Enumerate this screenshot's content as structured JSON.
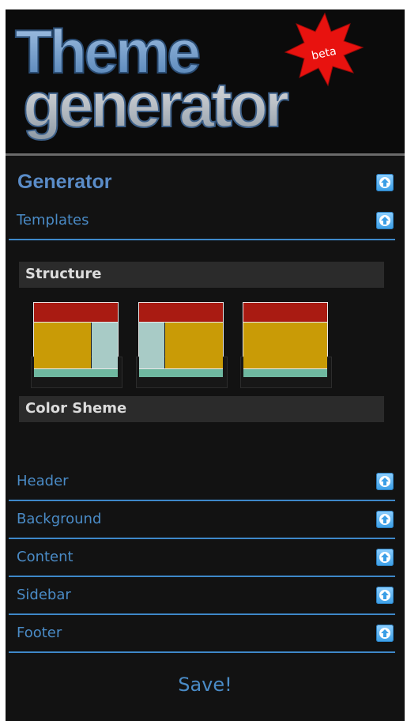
{
  "logo": {
    "line1": "Theme",
    "line2": "generator",
    "badge": "beta"
  },
  "generator": {
    "title": "Generator"
  },
  "sections": {
    "templates": "Templates",
    "header": "Header",
    "background": "Background",
    "content": "Content",
    "sidebar": "Sidebar",
    "footer": "Footer"
  },
  "templates_panel": {
    "structure_label": "Structure",
    "color_scheme_label": "Color Sheme",
    "layouts": [
      "main-right-sidebar",
      "left-sidebar-main",
      "full-width"
    ]
  },
  "save_label": "Save!",
  "colors": {
    "background": "#121212",
    "accent_blue": "#4a8bc6",
    "layout_header": "#a91b12",
    "layout_main": "#c99b06",
    "layout_sidebar": "#a8cbc6",
    "layout_footer": "#6fb8a0"
  },
  "icons": {
    "collapse": "arrow-up-icon",
    "badge": "starburst-badge-icon"
  }
}
